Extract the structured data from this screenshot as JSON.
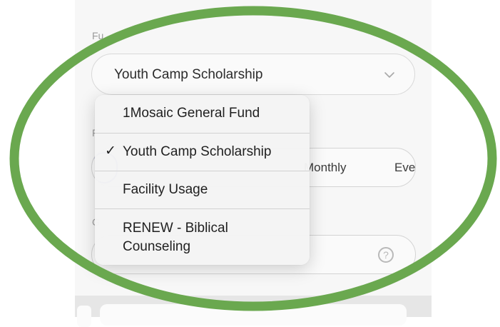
{
  "fund": {
    "label_fragment": "Fu",
    "selected_value": "Youth Camp Scholarship"
  },
  "frequency": {
    "label_fragment": "F",
    "options_visible": [
      "Monthly",
      "Eve"
    ]
  },
  "amount": {
    "label_fragment": "G",
    "help_glyph": "?"
  },
  "dropdown": {
    "items": [
      {
        "label": "1Mosaic General Fund",
        "checked": false
      },
      {
        "label": "Youth Camp Scholarship",
        "checked": true
      },
      {
        "label": "Facility Usage",
        "checked": false
      },
      {
        "label": "RENEW - Biblical Counseling",
        "checked": false
      }
    ],
    "check_glyph": "✓"
  },
  "colors": {
    "highlight_ring": "#6aa84f",
    "selected_frequency_outline": "#7a86d0"
  },
  "icons": [
    "chevron-down-icon",
    "question-circle-icon",
    "checkmark-icon"
  ]
}
